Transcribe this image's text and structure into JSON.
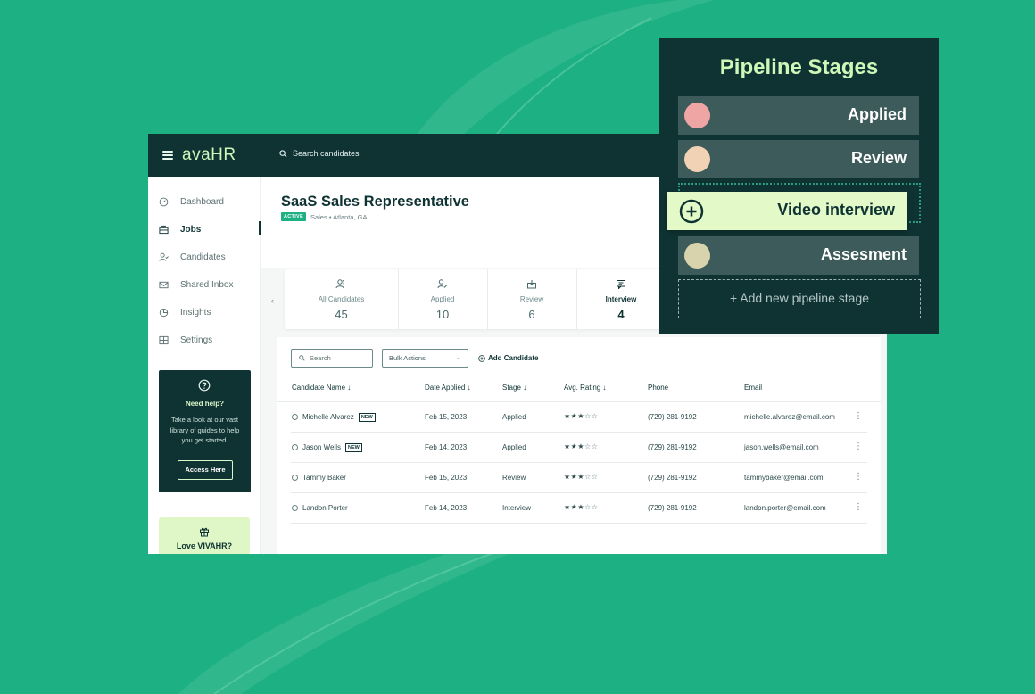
{
  "app": {
    "logo": "avaHR",
    "search_placeholder": "Search candidates"
  },
  "sidebar": {
    "items": [
      {
        "label": "Dashboard",
        "icon": "gauge-icon"
      },
      {
        "label": "Jobs",
        "icon": "briefcase-icon",
        "active": true
      },
      {
        "label": "Candidates",
        "icon": "user-check-icon"
      },
      {
        "label": "Shared Inbox",
        "icon": "mail-icon"
      },
      {
        "label": "Insights",
        "icon": "pie-chart-icon"
      },
      {
        "label": "Settings",
        "icon": "settings-grid-icon"
      }
    ],
    "help": {
      "title": "Need help?",
      "description": "Take a look at our vast library of guides to help you get started.",
      "button": "Access Here"
    },
    "love": "Love VIVAHR?"
  },
  "job": {
    "title": "SaaS Sales Representative",
    "status": "ACTIVE",
    "meta": "Sales • Atlanta, GA"
  },
  "stats": [
    {
      "label": "All Candidates",
      "value": "45"
    },
    {
      "label": "Applied",
      "value": "10"
    },
    {
      "label": "Review",
      "value": "6"
    },
    {
      "label": "Interview",
      "value": "4",
      "active": true
    }
  ],
  "table": {
    "search_placeholder": "Search",
    "bulk_actions": "Bulk Actions",
    "add_candidate": "Add Candidate",
    "columns": [
      "Candidate Name ↓",
      "Date Applied ↓",
      "Stage ↓",
      "Avg. Rating ↓",
      "Phone",
      "Email"
    ],
    "new_label": "NEW",
    "rows": [
      {
        "name": "Michelle Alvarez",
        "new": true,
        "date": "Feb 15, 2023",
        "stage": "Applied",
        "rating": 3,
        "phone": "(729) 281-9192",
        "email": "michelle.alvarez@email.com"
      },
      {
        "name": "Jason Wells",
        "new": true,
        "date": "Feb 14, 2023",
        "stage": "Applied",
        "rating": 3,
        "phone": "(729) 281-9192",
        "email": "jason.wells@email.com"
      },
      {
        "name": "Tammy Baker",
        "new": false,
        "date": "Feb 15, 2023",
        "stage": "Review",
        "rating": 3,
        "phone": "(729) 281-9192",
        "email": "tammybaker@email.com"
      },
      {
        "name": "Landon Porter",
        "new": false,
        "date": "Feb 14, 2023",
        "stage": "Interview",
        "rating": 3,
        "phone": "(729) 281-9192",
        "email": "landon.porter@email.com"
      }
    ]
  },
  "pipeline": {
    "title": "Pipeline Stages",
    "stages": [
      {
        "name": "Applied",
        "color": "#f0a5a5"
      },
      {
        "name": "Review",
        "color": "#f2d2b4"
      },
      {
        "name": "Assesment",
        "color": "#d8d3ad"
      }
    ],
    "dragging": "Video interview",
    "add_stage": "+ Add new pipeline stage"
  },
  "colors": {
    "background": "#1db082",
    "dark": "#0f3333",
    "accent": "#cff7b8"
  }
}
